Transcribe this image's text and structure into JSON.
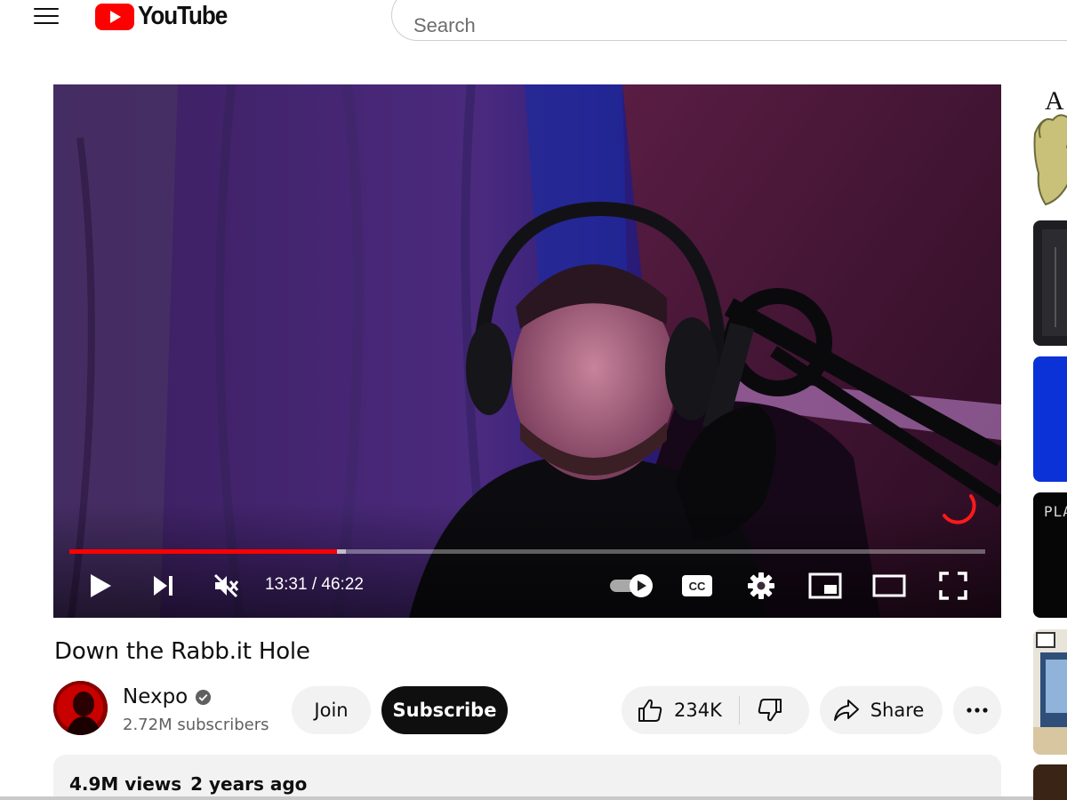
{
  "header": {
    "logo_text": "YouTube",
    "search_placeholder": "Search"
  },
  "player": {
    "current_time": "13:31",
    "separator": " / ",
    "duration": "46:22",
    "progress_fraction": 0.292,
    "buffer_fraction": 0.302,
    "muted": true,
    "cc_label": "CC",
    "accent_color": "#ff0000"
  },
  "video": {
    "title": "Down the Rabb.it Hole"
  },
  "channel": {
    "name": "Nexpo",
    "subscribers": "2.72M subscribers",
    "verified": true
  },
  "actions": {
    "join_label": "Join",
    "subscribe_label": "Subscribe",
    "like_count": "234K",
    "share_label": "Share"
  },
  "description": {
    "views": "4.9M views",
    "age": "2 years ago"
  },
  "recommendations": [
    {
      "thumb_text": "A",
      "bg": "#ffffff"
    },
    {
      "thumb_text": "",
      "bg": "#1e1e22"
    },
    {
      "thumb_text": "",
      "bg": "#0a32d6"
    },
    {
      "thumb_text": "PLA",
      "bg": "#060606"
    },
    {
      "thumb_text": "",
      "bg": "#e9e4d9"
    },
    {
      "thumb_text": "",
      "bg": "#3a2416"
    }
  ]
}
